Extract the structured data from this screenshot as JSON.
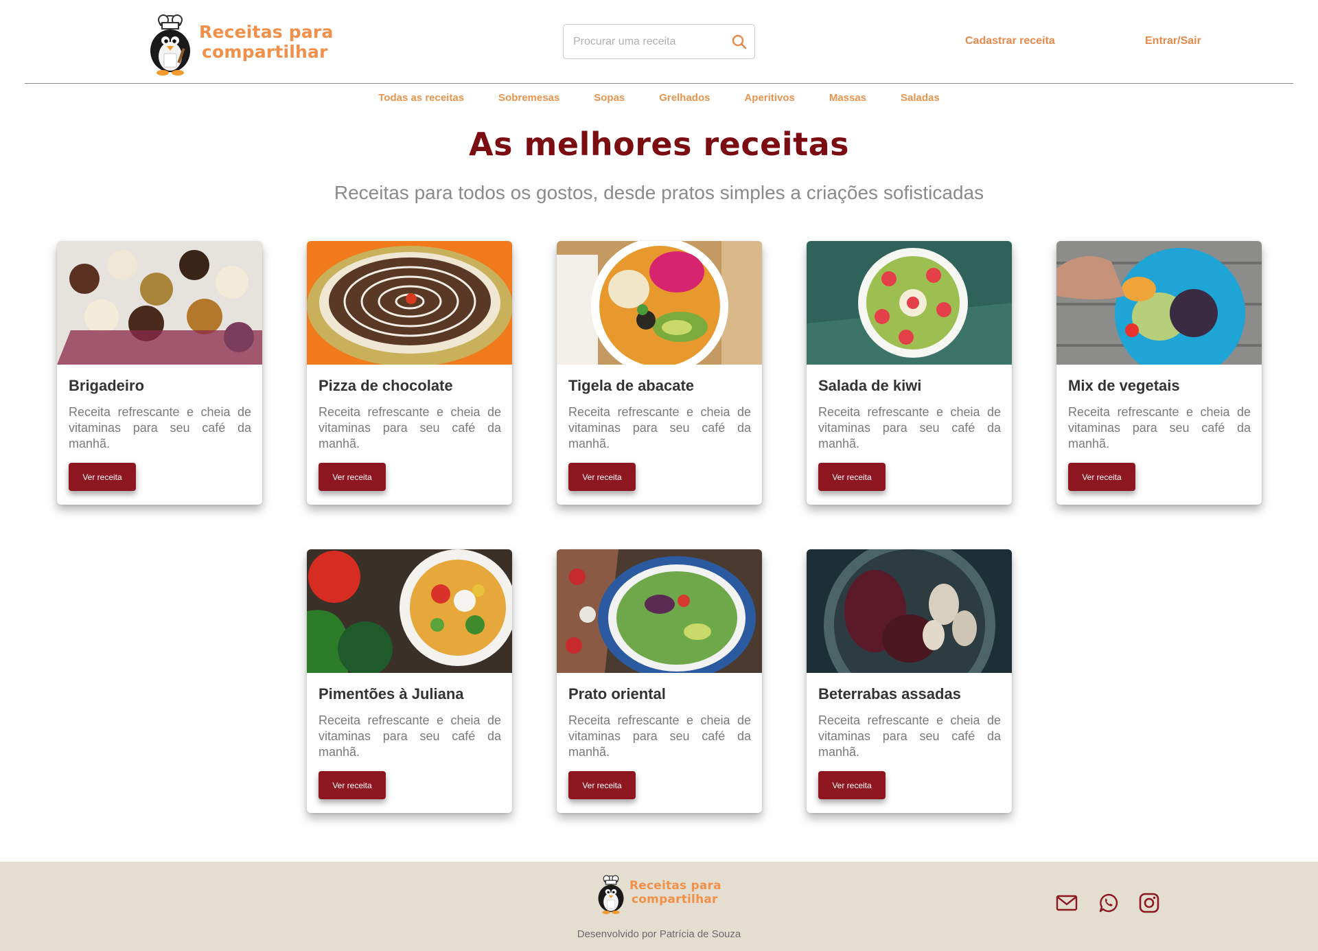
{
  "brand": {
    "line1": "Receitas para",
    "line2": "compartilhar"
  },
  "search": {
    "placeholder": "Procurar uma receita"
  },
  "header": {
    "register_label": "Cadastrar receita",
    "login_label": "Entrar/Sair"
  },
  "categories": [
    "Todas as receitas",
    "Sobremesas",
    "Sopas",
    "Grelhados",
    "Aperitivos",
    "Massas",
    "Saladas"
  ],
  "hero": {
    "title": "As melhores receitas",
    "subtitle": "Receitas para todos os gostos, desde pratos simples a criações sofisticadas"
  },
  "recipes": [
    {
      "title": "Brigadeiro",
      "description": "Receita refrescante e cheia de vitaminas para seu café da manhã.",
      "button": "Ver receita"
    },
    {
      "title": "Pizza de chocolate",
      "description": "Receita refrescante e cheia de vitaminas para seu café da manhã.",
      "button": "Ver receita"
    },
    {
      "title": "Tigela de abacate",
      "description": "Receita refrescante e cheia de vitaminas para seu café da manhã.",
      "button": "Ver receita"
    },
    {
      "title": "Salada de kiwi",
      "description": "Receita refrescante e cheia de vitaminas para seu café da manhã.",
      "button": "Ver receita"
    },
    {
      "title": "Mix de vegetais",
      "description": "Receita refrescante e cheia de vitaminas para seu café da manhã.",
      "button": "Ver receita"
    },
    {
      "title": "Pimentões à Juliana",
      "description": "Receita refrescante e cheia de vitaminas para seu café da manhã.",
      "button": "Ver receita"
    },
    {
      "title": "Prato oriental",
      "description": "Receita refrescante e cheia de vitaminas para seu café da manhã.",
      "button": "Ver receita"
    },
    {
      "title": "Beterrabas assadas",
      "description": "Receita refrescante e cheia de vitaminas para seu café da manhã.",
      "button": "Ver receita"
    }
  ],
  "footer": {
    "credit": "Desenvolvido por Patrícia de Souza",
    "social": [
      "mail-icon",
      "whatsapp-icon",
      "instagram-icon"
    ]
  },
  "colors": {
    "accent": "#e8884a",
    "brand_dark": "#7a0c12",
    "button": "#8e1620",
    "footer_bg": "#e4ded1"
  }
}
